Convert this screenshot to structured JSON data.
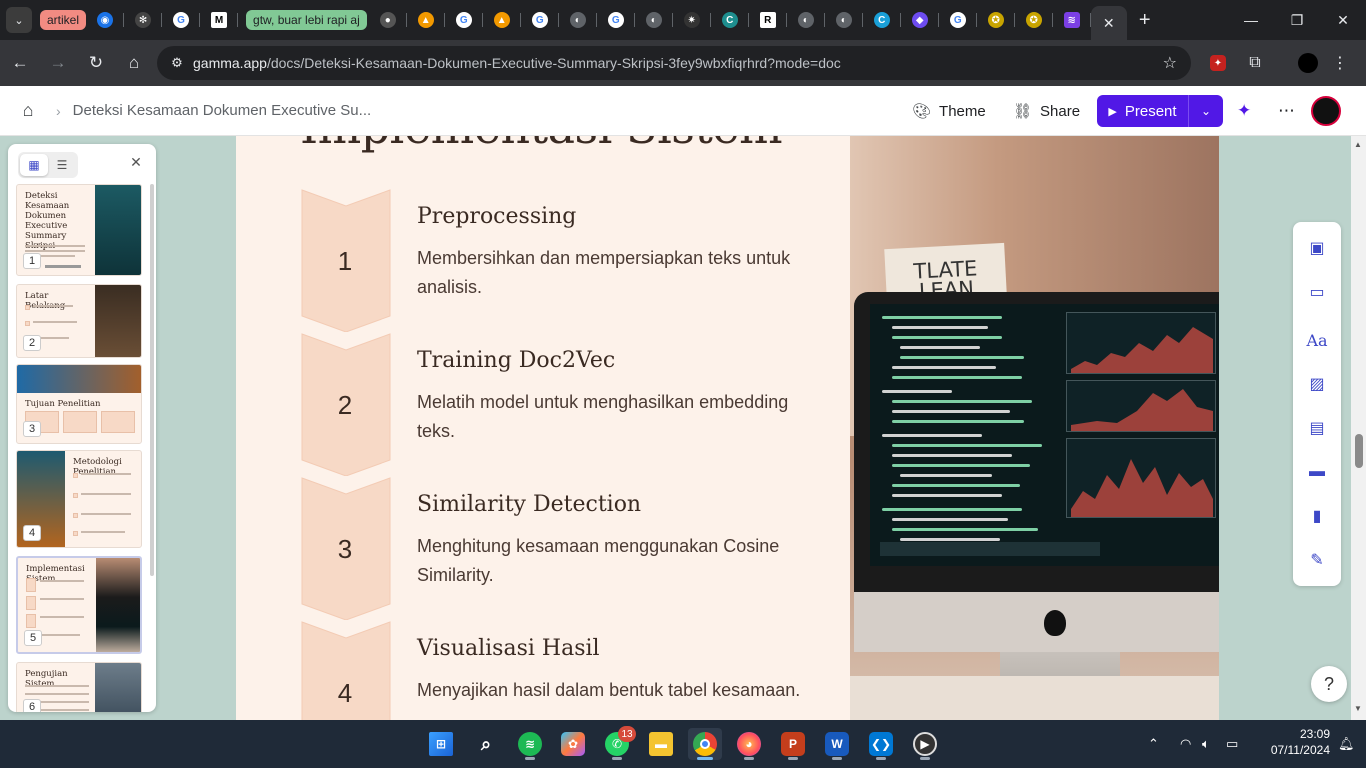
{
  "browser": {
    "tab_groups": [
      {
        "label": "artikel",
        "color": "#f28b82"
      },
      {
        "label": "gtw, buar lebi rapi aj",
        "color": "#81c995"
      }
    ],
    "active_tab_close": "✕",
    "new_tab": "+",
    "url_host": "gamma.app",
    "url_path": "/docs/Deteksi-Kesamaan-Dokumen-Executive-Summary-Skripsi-3fey9wbxfiqrhrd?mode=doc"
  },
  "header": {
    "breadcrumb": "Deteksi Kesamaan Dokumen Executive Su...",
    "theme_label": "Theme",
    "share_label": "Share",
    "present_label": "Present"
  },
  "doc": {
    "section_title": "Implementasi Sistem",
    "steps": [
      {
        "num": "1",
        "title": "Preprocessing",
        "desc": "Membersihkan dan mempersiapkan teks untuk analisis."
      },
      {
        "num": "2",
        "title": "Training Doc2Vec",
        "desc": "Melatih model untuk menghasilkan embedding teks."
      },
      {
        "num": "3",
        "title": "Similarity Detection",
        "desc": "Menghitung kesamaan menggunakan Cosine Similarity."
      },
      {
        "num": "4",
        "title": "Visualisasi Hasil",
        "desc": "Menyajikan hasil dalam bentuk tabel kesamaan."
      }
    ],
    "image_sign_text": "TLATE LEAN"
  },
  "sidebar": {
    "cards": [
      {
        "num": "1",
        "title": "Deteksi Kesamaan Dokumen Executive Summary Skripsi"
      },
      {
        "num": "2",
        "title": "Latar Belakang"
      },
      {
        "num": "3",
        "title": "Tujuan Penelitian"
      },
      {
        "num": "4",
        "title": "Metodologi Penelitian"
      },
      {
        "num": "5",
        "title": "Implementasi Sistem"
      },
      {
        "num": "6",
        "title": "Pengujian Sistem"
      }
    ]
  },
  "help_label": "?",
  "taskbar": {
    "whatsapp_badge": "13",
    "time": "23:09",
    "date": "07/11/2024"
  },
  "colors": {
    "accent": "#5118e6",
    "doc_bg": "#fdf2ea",
    "chevron": "#f7d9c6"
  }
}
